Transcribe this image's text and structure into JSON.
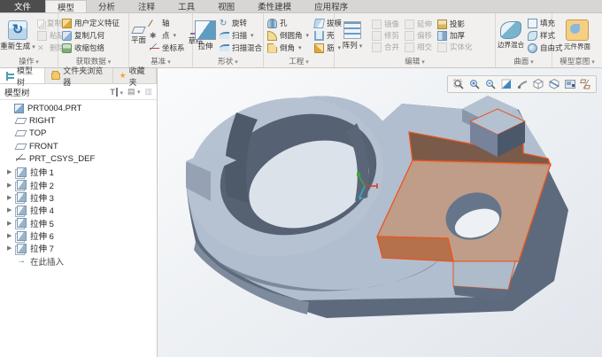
{
  "menu": {
    "tabs": [
      "文件",
      "模型",
      "分析",
      "注释",
      "工具",
      "视图",
      "柔性建模",
      "应用程序"
    ],
    "active_tab": "模型"
  },
  "ribbon": {
    "groups": [
      {
        "label": "操作",
        "items": [
          "重新生成",
          "复制",
          "粘贴",
          "删除"
        ]
      },
      {
        "label": "获取数据",
        "items": [
          "用户定义特征",
          "复制几何",
          "收缩包络"
        ]
      },
      {
        "label": "基准",
        "items": [
          "平面",
          "轴",
          "点",
          "坐标系",
          "草绘"
        ]
      },
      {
        "label": "形状",
        "items": [
          "拉伸",
          "旋转",
          "扫描",
          "扫描混合"
        ]
      },
      {
        "label": "工程",
        "items": [
          "孔",
          "倒圆角",
          "倒角",
          "拔模",
          "壳",
          "筋"
        ]
      },
      {
        "label": "编辑",
        "items": [
          "阵列",
          "镜像",
          "延伸",
          "投影",
          "修剪",
          "偏移",
          "加厚",
          "合并",
          "相交",
          "实体化"
        ]
      },
      {
        "label": "曲面",
        "items": [
          "边界混合",
          "填充",
          "样式",
          "自由式"
        ]
      },
      {
        "label": "模型意图",
        "items": [
          "元件界面"
        ]
      }
    ]
  },
  "tree_panel": {
    "tabs": [
      "模型树",
      "文件夹浏览器",
      "收藏夹"
    ],
    "active_tab": "模型树",
    "header": "模型树",
    "items": [
      {
        "label": "PRT0004.PRT",
        "icon": "part-icon",
        "expandable": false
      },
      {
        "label": "RIGHT",
        "icon": "datum-plane-icon",
        "expandable": false
      },
      {
        "label": "TOP",
        "icon": "datum-plane-icon",
        "expandable": false
      },
      {
        "label": "FRONT",
        "icon": "datum-plane-icon",
        "expandable": false
      },
      {
        "label": "PRT_CSYS_DEF",
        "icon": "csys-icon",
        "expandable": false
      },
      {
        "label": "拉伸 1",
        "icon": "extrude-icon",
        "expandable": true
      },
      {
        "label": "拉伸 2",
        "icon": "extrude-icon",
        "expandable": true
      },
      {
        "label": "拉伸 3",
        "icon": "extrude-icon",
        "expandable": true
      },
      {
        "label": "拉伸 4",
        "icon": "extrude-icon",
        "expandable": true
      },
      {
        "label": "拉伸 5",
        "icon": "extrude-icon",
        "expandable": true
      },
      {
        "label": "拉伸 6",
        "icon": "extrude-icon",
        "expandable": true
      },
      {
        "label": "拉伸 7",
        "icon": "extrude-icon",
        "expandable": true
      },
      {
        "label": "在此插入",
        "icon": "insert-here-icon",
        "expandable": false
      }
    ]
  },
  "viewport": {
    "toolbar_icons": [
      "refit",
      "zoom-in",
      "zoom-out",
      "repaint",
      "spin-center",
      "display-style",
      "section-view",
      "view-manager",
      "datum-display-filters"
    ],
    "model": {
      "part_name": "PRT0004.PRT",
      "selected_feature": "拉伸 (选定)",
      "colors": {
        "body_top": "#b1becf",
        "body_side": "#5d6a7d",
        "selection_edge": "#e8551e",
        "selection_face": "#c09a82",
        "selection_face_dark": "#7a5a49",
        "background": "#e9ecef"
      }
    }
  }
}
